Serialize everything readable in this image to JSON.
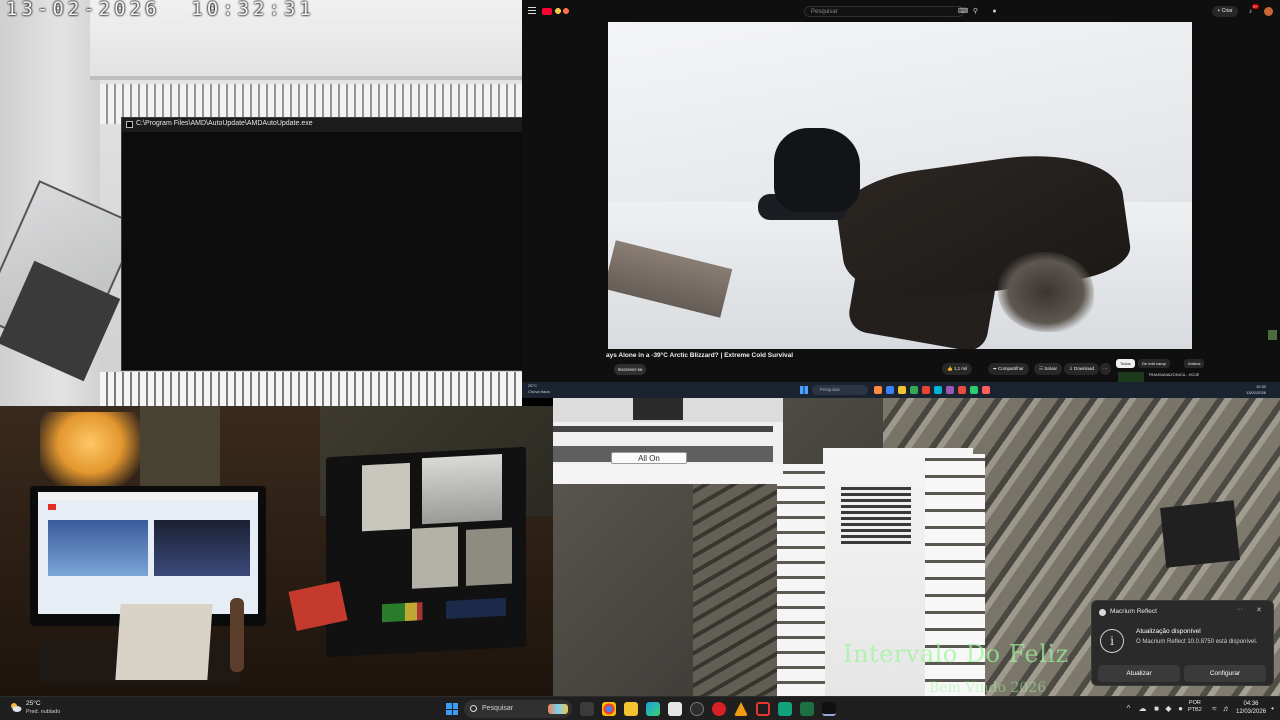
{
  "cctv_top_left": {
    "timestamp": "13-02-2026  10:32:31"
  },
  "cmd_window": {
    "title": "C:\\Program Files\\AMD\\AutoUpdate\\AMDAutoUpdate.exe",
    "icons": {
      "minimize": "minimize-icon",
      "maximize": "maximize-icon",
      "close": "close-icon"
    }
  },
  "browser": {
    "search_placeholder": "Pesquisar",
    "create_label": "+ Criar",
    "notification_count": "9+",
    "video_title": "ays Alone in a -39°C Arctic Blizzard? | Extreme Cold Survival",
    "channel_button": "Inscrever-se",
    "actions": {
      "like": "1,1 mil",
      "share": "Compartilhar",
      "save": "Salvar",
      "download": "Download",
      "more": "···"
    },
    "filters": [
      "Todos",
      "De edd camp",
      "Ambos"
    ],
    "side_video": "TRANSAMAZONICA - HOJE"
  },
  "inner_taskbar": {
    "weather": "25°C\nChuva fraca",
    "search": "Pesquisar",
    "lang": "POR\nPTB2",
    "time": "10:32\n13/02/2026"
  },
  "allon_panel": {
    "button_label": "All On"
  },
  "overlay": {
    "line1": "Intervalo Do Feliz",
    "line2": "Bem Vindo 2026"
  },
  "toast": {
    "app_name": "Macrium Reflect",
    "title": "Atualização disponível",
    "body": "O Macrium Reflect 10.0.8750 está disponível.",
    "button_update": "Atualizar",
    "button_configure": "Configurar"
  },
  "taskbar": {
    "weather_temp": "25°C",
    "weather_desc": "Pred. nublado",
    "search": "Pesquisar",
    "lang_line1": "POR",
    "lang_line2": "PTB2",
    "time": "04:36",
    "date": "12/03/2026",
    "tray_expand": "^"
  },
  "colors": {
    "accent": "#3a9df8",
    "youtube_red": "#ff0033",
    "overlay_green": "#9cf59a"
  }
}
